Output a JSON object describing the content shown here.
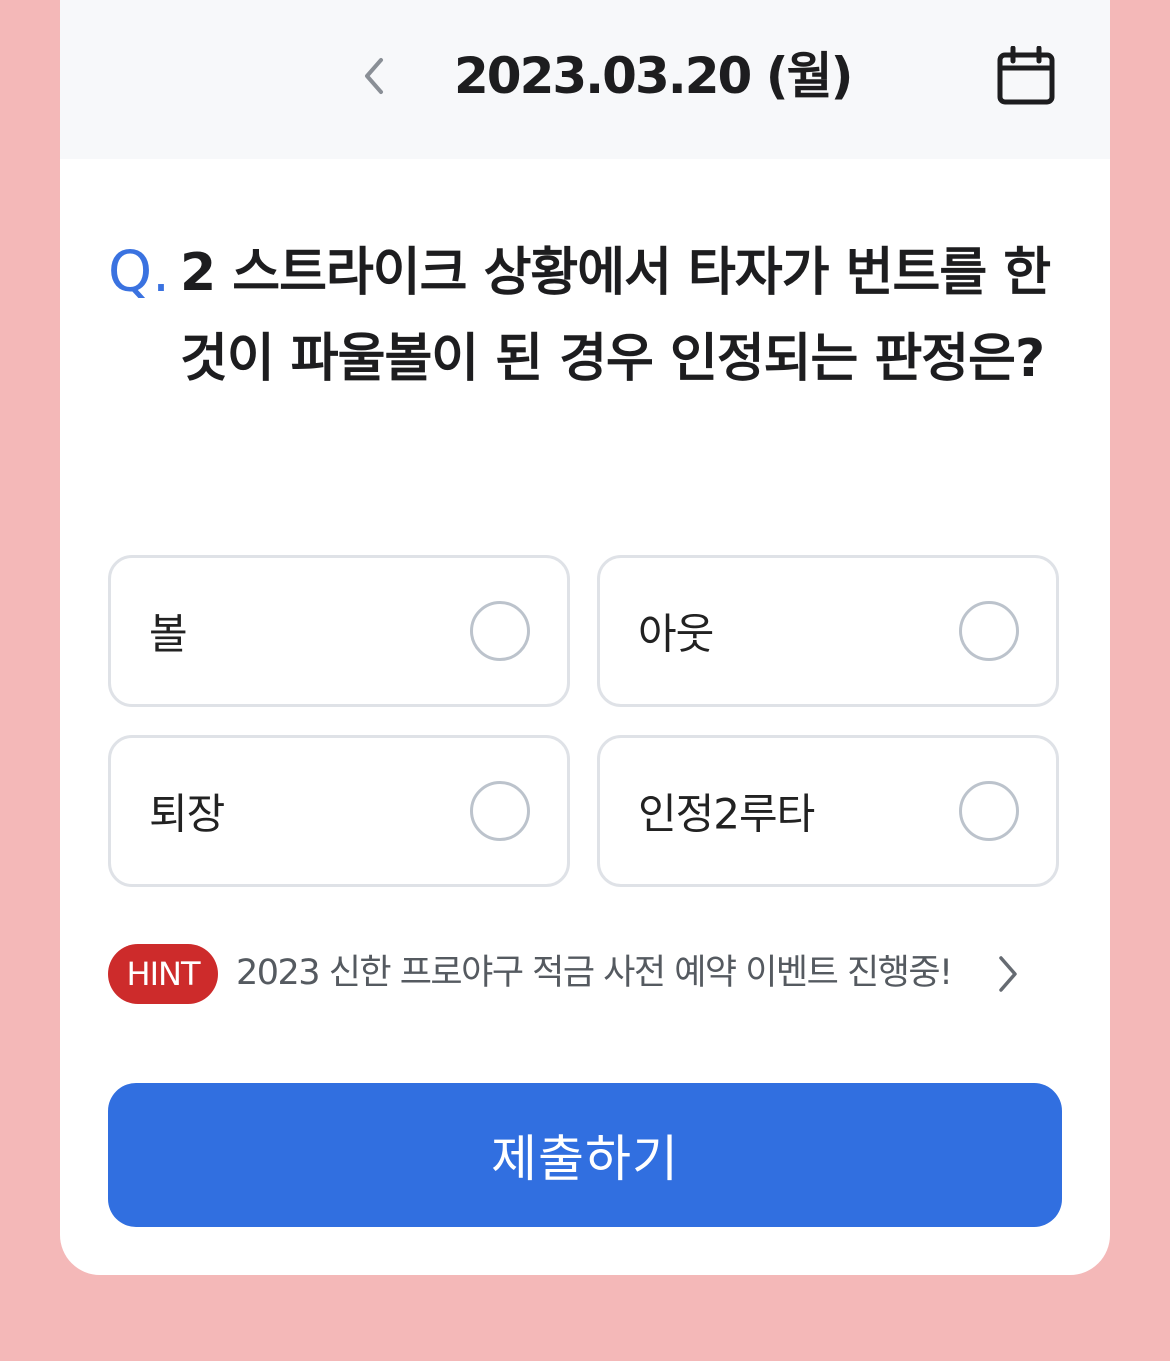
{
  "header": {
    "date": "2023.03.20 (월)",
    "prev_icon": "chevron-left-icon",
    "calendar_icon": "calendar-icon"
  },
  "question": {
    "prefix": "Q.",
    "text": "2 스트라이크 상황에서 타자가 번트를 한 것이 파울볼이 된 경우 인정되는 판정은?"
  },
  "options": [
    {
      "label": "볼",
      "selected": false
    },
    {
      "label": "아웃",
      "selected": false
    },
    {
      "label": "퇴장",
      "selected": false
    },
    {
      "label": "인정2루타",
      "selected": false
    }
  ],
  "hint": {
    "badge": "HINT",
    "text": "2023 신한 프로야구 적금 사전 예약 이벤트 진행중!",
    "icon": "chevron-right-icon"
  },
  "submit": {
    "label": "제출하기"
  },
  "colors": {
    "background": "#f4b8b8",
    "accent": "#316fe0",
    "hint_badge": "#cd2b2b",
    "question_prefix": "#3a72e0"
  }
}
